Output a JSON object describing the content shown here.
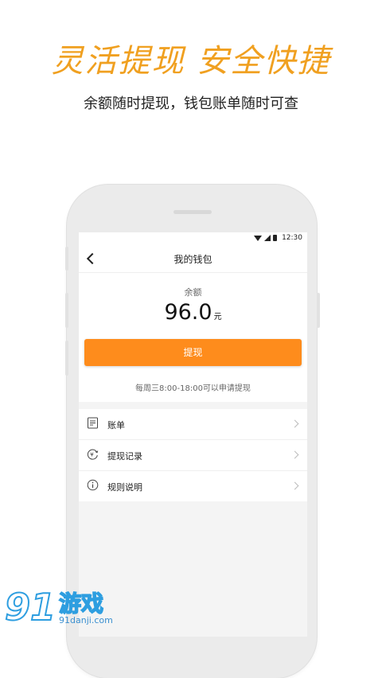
{
  "promo": {
    "headline": "灵活提现 安全快捷",
    "subline": "余额随时提现，钱包账单随时可查"
  },
  "status_bar": {
    "time": "12:30",
    "icons": [
      "wifi-icon",
      "signal-icon",
      "battery-icon"
    ]
  },
  "nav": {
    "back_icon": "chevron-left-icon",
    "title": "我的钱包"
  },
  "balance": {
    "label": "余额",
    "amount": "96.0",
    "unit": "元"
  },
  "withdraw": {
    "button_label": "提现",
    "notice": "每周三8:00-18:00可以申请提现"
  },
  "menu": {
    "items": [
      {
        "label": "账单",
        "icon": "bill-icon"
      },
      {
        "label": "提现记录",
        "icon": "withdraw-record-icon"
      },
      {
        "label": "规则说明",
        "icon": "info-icon"
      }
    ]
  },
  "watermark": {
    "logo": "91",
    "text": "游戏",
    "url": "91danji.com"
  },
  "colors": {
    "accent": "#fe8c1c",
    "headline": "#f0a020",
    "watermark": "#2e9ee0"
  }
}
